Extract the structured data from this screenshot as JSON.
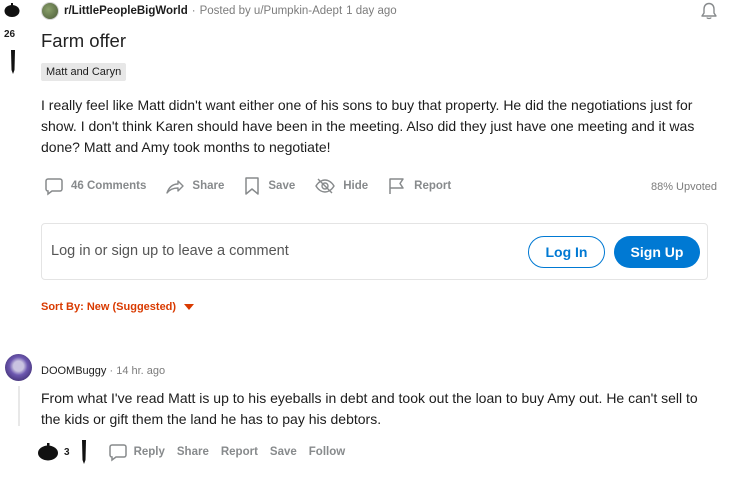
{
  "post": {
    "subreddit": "r/LittlePeopleBigWorld",
    "posted_by": "Posted by u/Pumpkin-Adept",
    "time": "1 day ago",
    "votes": "26",
    "title": "Farm offer",
    "flair": "Matt and Caryn",
    "body": "I really feel like Matt didn't want either one of his sons to buy that property. He did the negotiations just for show. I don't think Karen should have been in the meeting. Also did they just have one meeting and it was done? Matt and Amy took months to negotiate!",
    "actions": {
      "comments": "46 Comments",
      "share": "Share",
      "save": "Save",
      "hide": "Hide",
      "report": "Report"
    },
    "upvoted": "88% Upvoted"
  },
  "login": {
    "prompt": "Log in or sign up to leave a comment",
    "login_label": "Log In",
    "signup_label": "Sign Up"
  },
  "sort": {
    "label": "Sort By: New (Suggested)"
  },
  "comment": {
    "author": "DOOMBuggy",
    "separator": "·",
    "time": "14 hr. ago",
    "body": "From what I've read Matt is up to his eyeballs in debt and took out the loan to buy Amy out. He can't sell to the kids or gift them the land he has to pay his debtors.",
    "votes": "3",
    "actions": {
      "reply": "Reply",
      "share": "Share",
      "report": "Report",
      "save": "Save",
      "follow": "Follow"
    }
  },
  "colors": {
    "accent_blue": "#0079d3",
    "sort_orange": "#d93a00",
    "muted_gray": "#878a8c"
  },
  "icons": [
    "upvote-icon",
    "downvote-icon",
    "bell-icon",
    "comment-icon",
    "share-icon",
    "save-icon",
    "hide-icon",
    "report-icon",
    "chevron-down-icon",
    "reply-icon"
  ]
}
